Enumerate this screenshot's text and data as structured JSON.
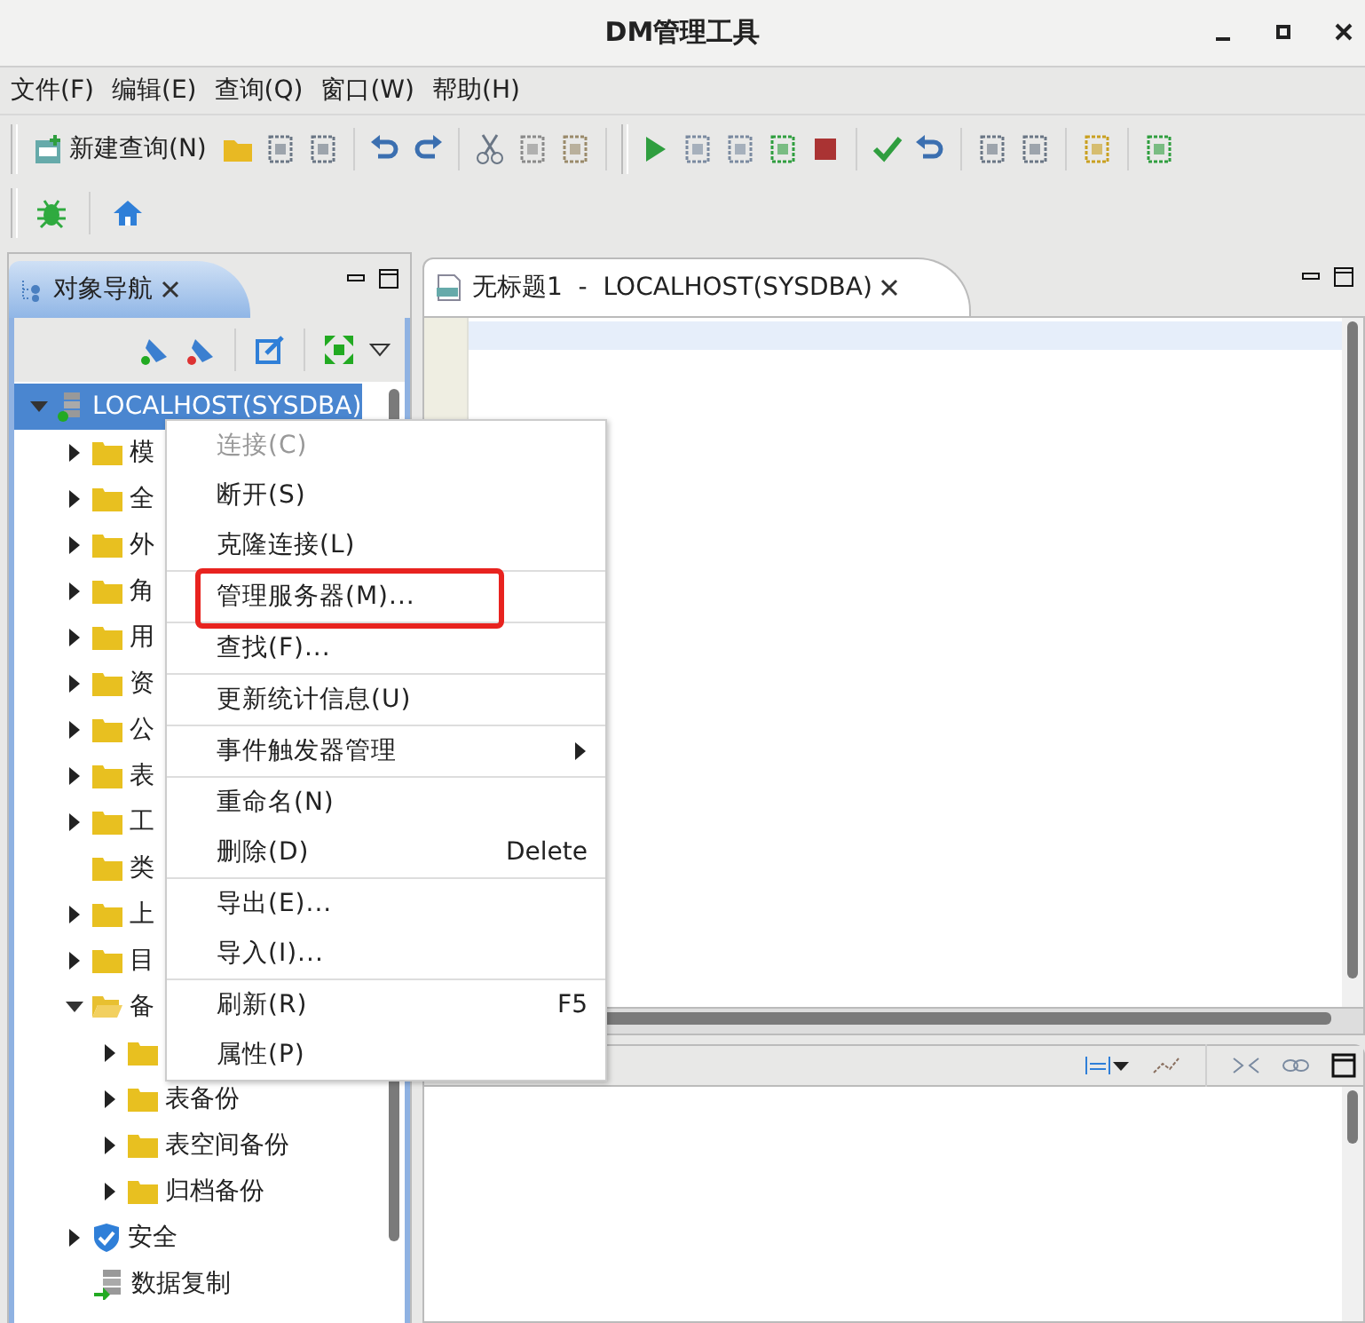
{
  "window": {
    "title": "DM管理工具"
  },
  "menu_bar": [
    "文件(F)",
    "编辑(E)",
    "查询(Q)",
    "窗口(W)",
    "帮助(H)"
  ],
  "toolbar": {
    "new_query_label": "新建查询(N)"
  },
  "navigator": {
    "tab": {
      "label": "对象导航",
      "selected": true
    },
    "tree": [
      {
        "label": "LOCALHOST(SYSDBA)",
        "kind": "server",
        "expanded": true,
        "selected": true,
        "children": [
          {
            "label": "模",
            "kind": "folder",
            "expanded": false
          },
          {
            "label": "全",
            "kind": "folder",
            "expanded": false
          },
          {
            "label": "外",
            "kind": "folder",
            "expanded": false
          },
          {
            "label": "角",
            "kind": "folder",
            "expanded": false
          },
          {
            "label": "用",
            "kind": "folder",
            "expanded": false
          },
          {
            "label": "资",
            "kind": "folder",
            "expanded": false
          },
          {
            "label": "公",
            "kind": "folder",
            "expanded": false
          },
          {
            "label": "表",
            "kind": "folder",
            "expanded": false
          },
          {
            "label": "工",
            "kind": "folder",
            "expanded": false
          },
          {
            "label": "类",
            "kind": "leaf-folder"
          },
          {
            "label": "上",
            "kind": "folder",
            "expanded": false
          },
          {
            "label": "目",
            "kind": "folder",
            "expanded": false
          },
          {
            "label": "备",
            "kind": "folder",
            "expanded": true,
            "children": [
              {
                "kind": "folder",
                "expanded": false
              },
              {
                "label": "表备份",
                "kind": "folder",
                "expanded": false
              },
              {
                "label": "表空间备份",
                "kind": "folder",
                "expanded": false
              },
              {
                "label": "归档备份",
                "kind": "folder",
                "expanded": false
              }
            ]
          },
          {
            "label": "安全",
            "kind": "shield",
            "expanded": false
          },
          {
            "label": "数据复制",
            "kind": "replication"
          }
        ]
      }
    ]
  },
  "editor": {
    "tab": {
      "label": "无标题1  -  LOCALHOST(SYSDBA)",
      "selected": true
    }
  },
  "context_menu": {
    "groups": [
      [
        {
          "label": "连接(C)",
          "disabled": true
        },
        {
          "label": "断开(S)",
          "disabled": false
        },
        {
          "label": "克隆连接(L)",
          "disabled": false
        }
      ],
      [
        {
          "label": "管理服务器(M)...",
          "disabled": false,
          "highlighted": true
        }
      ],
      [
        {
          "label": "查找(F)...",
          "disabled": false
        }
      ],
      [
        {
          "label": "更新统计信息(U)",
          "disabled": false
        }
      ],
      [
        {
          "label": "事件触发器管理",
          "disabled": false,
          "submenu": true
        }
      ],
      [
        {
          "label": "重命名(N)",
          "disabled": false
        },
        {
          "label": "删除(D)",
          "disabled": false,
          "shortcut": "Delete"
        }
      ],
      [
        {
          "label": "导出(E)...",
          "disabled": false
        },
        {
          "label": "导入(I)...",
          "disabled": false
        }
      ],
      [
        {
          "label": "刷新(R)",
          "disabled": false,
          "shortcut": "F5"
        },
        {
          "label": "属性(P)",
          "disabled": false
        }
      ]
    ]
  }
}
